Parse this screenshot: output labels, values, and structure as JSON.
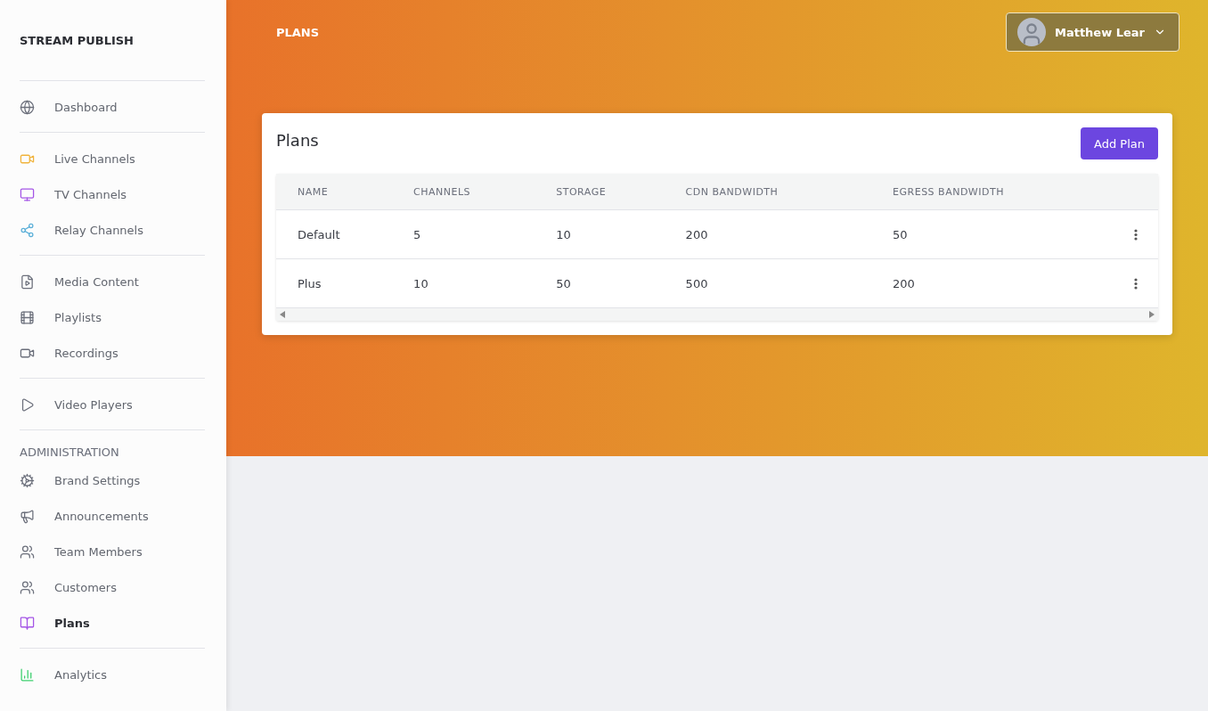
{
  "sidebar": {
    "brand": "STREAM PUBLISH",
    "sections": [
      {
        "items": [
          {
            "label": "Dashboard",
            "selected": false
          }
        ]
      },
      {
        "items": [
          {
            "label": "Live Channels",
            "selected": false
          },
          {
            "label": "TV Channels",
            "selected": false
          },
          {
            "label": "Relay Channels",
            "selected": false
          }
        ]
      },
      {
        "items": [
          {
            "label": "Media Content",
            "selected": false
          },
          {
            "label": "Playlists",
            "selected": false
          },
          {
            "label": "Recordings",
            "selected": false
          }
        ]
      },
      {
        "items": [
          {
            "label": "Video Players",
            "selected": false
          }
        ]
      },
      {
        "heading": "ADMINISTRATION",
        "items": [
          {
            "label": "Brand Settings",
            "selected": false
          },
          {
            "label": "Announcements",
            "selected": false
          },
          {
            "label": "Team Members",
            "selected": false
          },
          {
            "label": "Customers",
            "selected": false
          },
          {
            "label": "Plans",
            "selected": true
          }
        ]
      },
      {
        "items": [
          {
            "label": "Analytics",
            "selected": false
          }
        ]
      }
    ]
  },
  "header": {
    "page_title": "PLANS",
    "user": {
      "name": "Matthew Lear"
    }
  },
  "card": {
    "title": "Plans",
    "add_button": "Add Plan",
    "table": {
      "columns": [
        "NAME",
        "CHANNELS",
        "STORAGE",
        "CDN BANDWIDTH",
        "EGRESS BANDWIDTH"
      ],
      "rows": [
        {
          "cells": [
            "Default",
            "5",
            "10",
            "200",
            "50"
          ]
        },
        {
          "cells": [
            "Plus",
            "10",
            "50",
            "500",
            "200"
          ]
        }
      ]
    }
  }
}
